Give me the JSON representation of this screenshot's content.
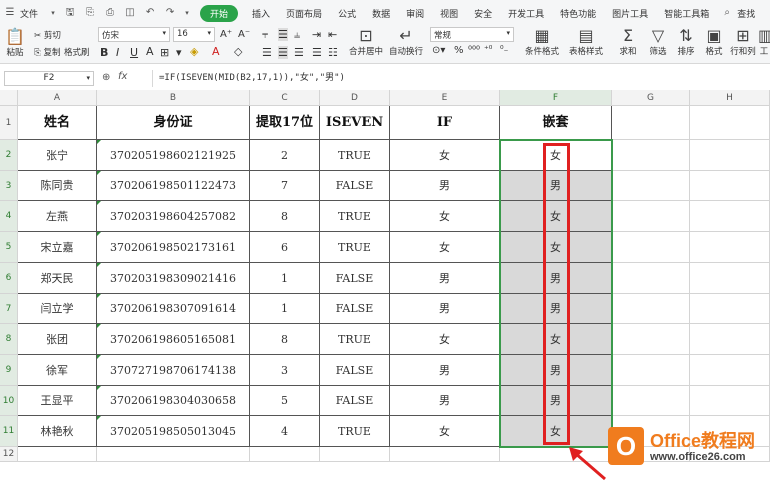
{
  "menubar": {
    "file_label": "文件",
    "items": [
      "开始",
      "插入",
      "页面布局",
      "公式",
      "数据",
      "审阅",
      "视图",
      "安全",
      "开发工具",
      "特色功能",
      "图片工具",
      "智能工具箱"
    ],
    "search_label": "查找",
    "active_color": "#2aa34a"
  },
  "toolbar": {
    "paste": "粘贴",
    "cut": "剪切",
    "copy": "复制",
    "format_painter": "格式刷",
    "font_name": "仿宋",
    "font_size": "16",
    "merge_center": "合并居中",
    "wrap_text": "自动换行",
    "number_format": "常规",
    "conditional_format": "条件格式",
    "table_style": "表格样式",
    "sum": "求和",
    "filter": "筛选",
    "sort": "排序",
    "format": "格式",
    "rows_cols": "行和列",
    "worksheet": "工"
  },
  "formula_bar": {
    "cell_ref": "F2",
    "fx": "fx",
    "formula": "=IF(ISEVEN(MID(B2,17,1)),\"女\",\"男\")"
  },
  "columns": [
    "A",
    "B",
    "C",
    "D",
    "E",
    "F",
    "G",
    "H"
  ],
  "rows": [
    "1",
    "2",
    "3",
    "4",
    "5",
    "6",
    "7",
    "8",
    "9",
    "10",
    "11",
    "12"
  ],
  "table": {
    "headers": [
      "姓名",
      "身份证",
      "提取17位",
      "ISEVEN",
      "IF",
      "嵌套"
    ],
    "data": [
      [
        "张宁",
        "370205198602121925",
        "2",
        "TRUE",
        "女",
        "女"
      ],
      [
        "陈同贵",
        "370206198501122473",
        "7",
        "FALSE",
        "男",
        "男"
      ],
      [
        "左燕",
        "370203198604257082",
        "8",
        "TRUE",
        "女",
        "女"
      ],
      [
        "宋立嘉",
        "370206198502173161",
        "6",
        "TRUE",
        "女",
        "女"
      ],
      [
        "郑天民",
        "370203198309021416",
        "1",
        "FALSE",
        "男",
        "男"
      ],
      [
        "闫立学",
        "370206198307091614",
        "1",
        "FALSE",
        "男",
        "男"
      ],
      [
        "张团",
        "370206198605165081",
        "8",
        "TRUE",
        "女",
        "女"
      ],
      [
        "徐军",
        "370727198706174138",
        "3",
        "FALSE",
        "男",
        "男"
      ],
      [
        "王显平",
        "370206198304030658",
        "5",
        "FALSE",
        "男",
        "男"
      ],
      [
        "林艳秋",
        "370205198505013045",
        "4",
        "TRUE",
        "女",
        "女"
      ]
    ]
  },
  "watermark": {
    "logo_letter": "O",
    "name": "Office教程网",
    "url": "www.office26.com"
  },
  "colors": {
    "selection": "#3a9a4b",
    "highlight": "#e02020",
    "selected_fill": "#d9d9d9",
    "brand": "#f07c1e"
  }
}
